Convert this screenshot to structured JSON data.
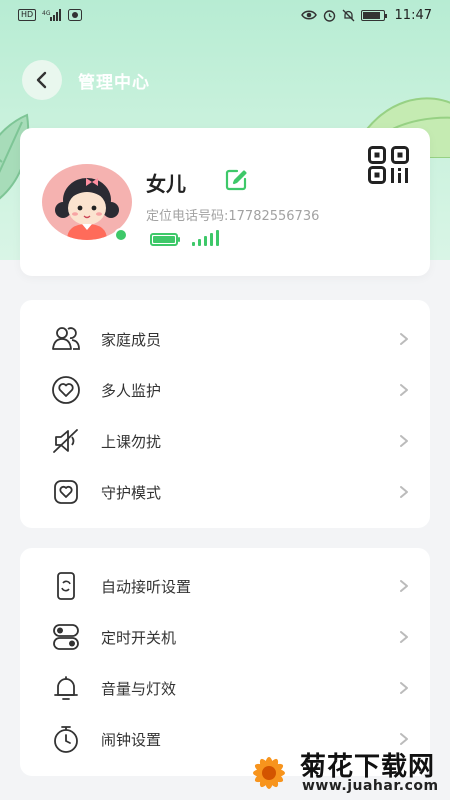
{
  "status_bar": {
    "hd": "HD",
    "network": "4G",
    "time": "11:47",
    "battery_level": 0.85
  },
  "header": {
    "title": "管理中心"
  },
  "profile": {
    "name": "女儿",
    "phone_text": "定位电话号码:17782556736",
    "device_battery_level": 1.0,
    "signal_bars": 5,
    "online": true
  },
  "menu_group_1": [
    {
      "label": "家庭成员",
      "icon": "family-members-icon"
    },
    {
      "label": "多人监护",
      "icon": "heart-shield-icon"
    },
    {
      "label": "上课勿扰",
      "icon": "mute-speaker-icon"
    },
    {
      "label": "守护模式",
      "icon": "guard-heart-icon"
    }
  ],
  "menu_group_2": [
    {
      "label": "自动接听设置",
      "icon": "phone-auto-answer-icon"
    },
    {
      "label": "定时开关机",
      "icon": "toggle-switch-icon"
    },
    {
      "label": "音量与灯效",
      "icon": "bell-icon"
    },
    {
      "label": "闹钟设置",
      "icon": "alarm-clock-icon"
    }
  ],
  "watermark": {
    "title": "菊花下载网",
    "url": "www.juahar.com"
  },
  "colors": {
    "accent_green": "#3ec869",
    "hero_bg": "#c8f1dc",
    "page_bg": "#f3f4f6"
  }
}
